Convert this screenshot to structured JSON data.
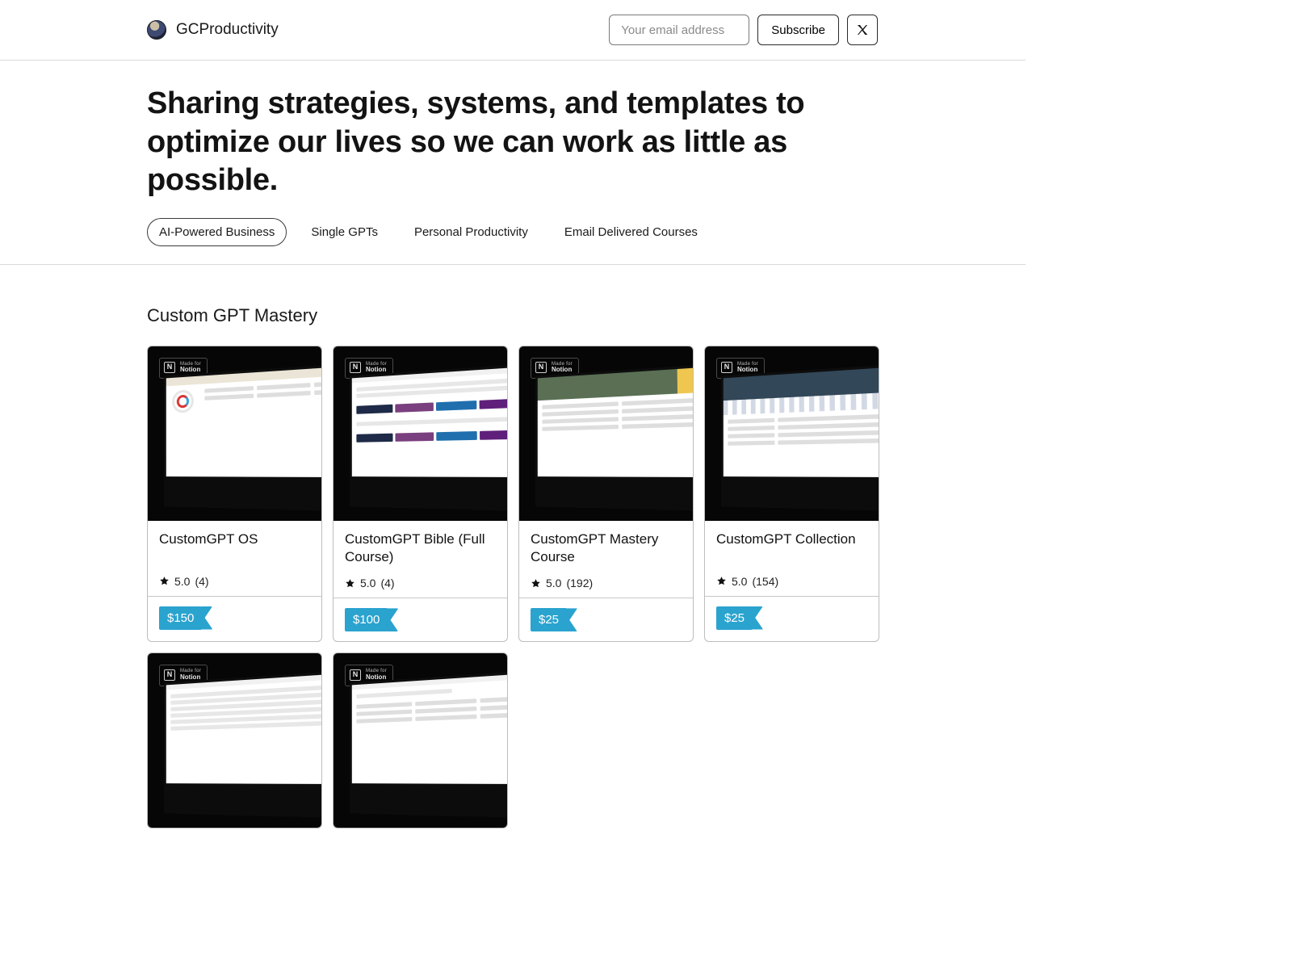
{
  "header": {
    "brand": "GCProductivity",
    "email_placeholder": "Your email address",
    "subscribe_label": "Subscribe"
  },
  "hero": {
    "title": "Sharing strategies, systems, and templates to optimize our lives so we can work as little as possible.",
    "tabs": [
      {
        "label": "AI-Powered Business",
        "active": true
      },
      {
        "label": "Single GPTs",
        "active": false
      },
      {
        "label": "Personal Productivity",
        "active": false
      },
      {
        "label": "Email Delivered Courses",
        "active": false
      }
    ]
  },
  "section": {
    "title": "Custom GPT Mastery",
    "notion_badge": {
      "line1": "Made for",
      "line2": "Notion"
    },
    "cards": [
      {
        "title": "CustomGPT OS",
        "rating": "5.0",
        "count": "(4)",
        "price": "$150",
        "variant": 1
      },
      {
        "title": "CustomGPT Bible (Full Course)",
        "rating": "5.0",
        "count": "(4)",
        "price": "$100",
        "variant": 2
      },
      {
        "title": "CustomGPT Mastery Course",
        "rating": "5.0",
        "count": "(192)",
        "price": "$25",
        "variant": 3
      },
      {
        "title": "CustomGPT Collection",
        "rating": "5.0",
        "count": "(154)",
        "price": "$25",
        "variant": 4
      },
      {
        "title": "",
        "rating": "",
        "count": "",
        "price": "",
        "variant": 5
      },
      {
        "title": "",
        "rating": "",
        "count": "",
        "price": "",
        "variant": 6
      }
    ]
  }
}
